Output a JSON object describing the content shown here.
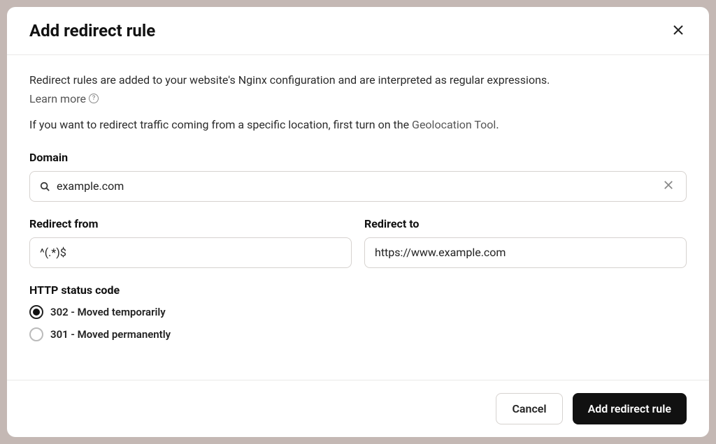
{
  "modal": {
    "title": "Add redirect rule",
    "description": "Redirect rules are added to your website's Nginx configuration and are interpreted as regular expressions.",
    "learn_more_label": "Learn more",
    "geo_text_prefix": "If you want to redirect traffic coming from a specific location, first turn on the ",
    "geo_link_label": "Geolocation Tool",
    "geo_text_suffix": "."
  },
  "fields": {
    "domain": {
      "label": "Domain",
      "value": "example.com"
    },
    "redirect_from": {
      "label": "Redirect from",
      "value": "^(.*)$"
    },
    "redirect_to": {
      "label": "Redirect to",
      "value": "https://www.example.com"
    },
    "status_code": {
      "label": "HTTP status code",
      "options": [
        {
          "label": "302 - Moved temporarily",
          "selected": true
        },
        {
          "label": "301 - Moved permanently",
          "selected": false
        }
      ]
    }
  },
  "footer": {
    "cancel_label": "Cancel",
    "submit_label": "Add redirect rule"
  }
}
